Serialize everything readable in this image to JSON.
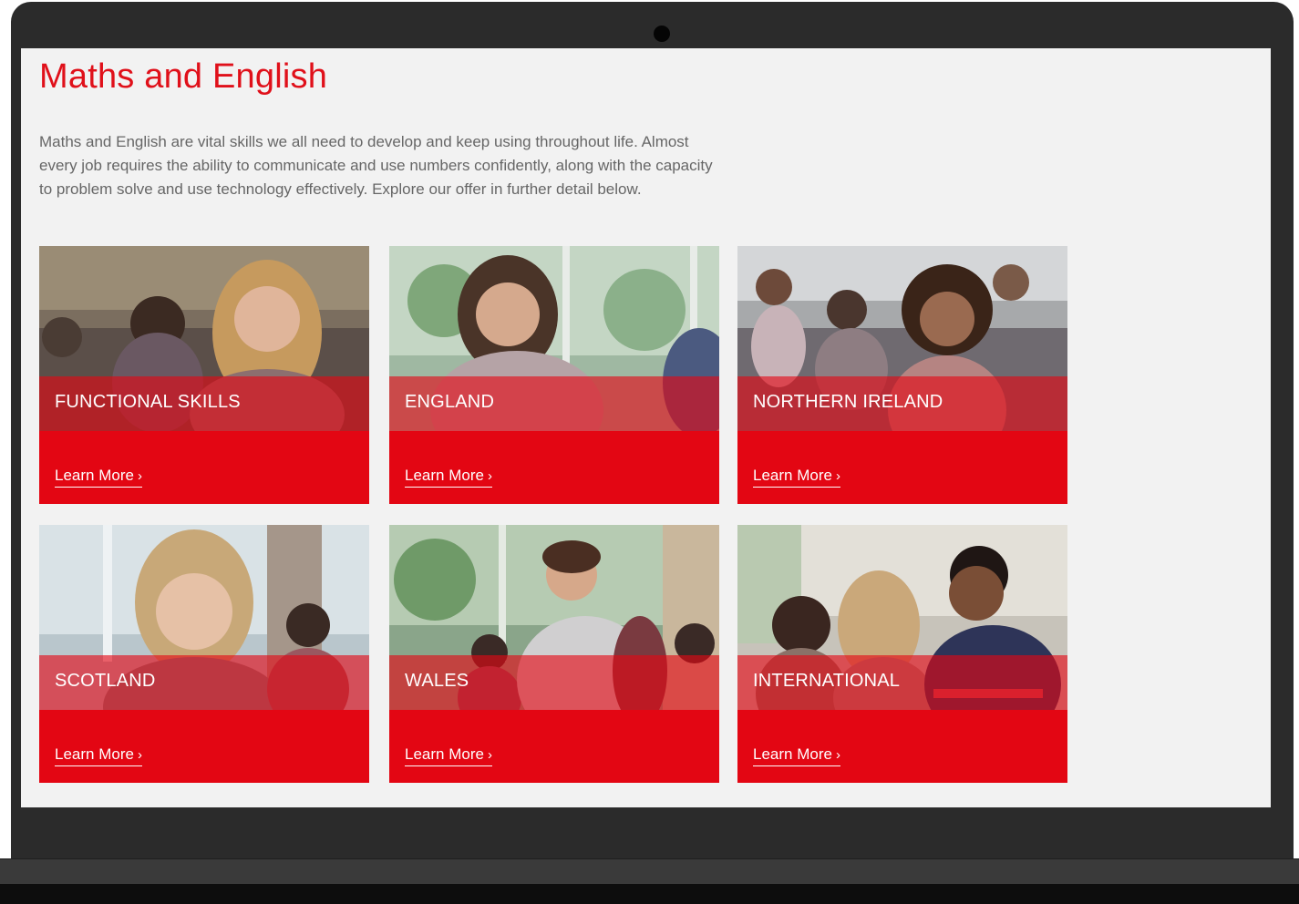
{
  "page": {
    "title": "Maths and English",
    "intro": "Maths and English are vital skills we all need to develop and keep using throughout life. Almost every job requires the ability to communicate and use numbers confidently, along with the capacity to problem solve and use technology effectively. Explore our offer in further detail below."
  },
  "cards": [
    {
      "title": "FUNCTIONAL SKILLS",
      "link": "Learn More",
      "chevron": "›"
    },
    {
      "title": "ENGLAND",
      "link": "Learn More",
      "chevron": "›"
    },
    {
      "title": "NORTHERN IRELAND",
      "link": "Learn More",
      "chevron": "›"
    },
    {
      "title": "SCOTLAND",
      "link": "Learn More",
      "chevron": "›"
    },
    {
      "title": "WALES",
      "link": "Learn More",
      "chevron": "›"
    },
    {
      "title": "INTERNATIONAL",
      "link": "Learn More",
      "chevron": "›"
    }
  ],
  "colors": {
    "accent": "#e30613",
    "heading": "#e0101a",
    "body_text": "#666666",
    "screen_bg": "#f2f2f2",
    "bezel": "#2b2b2b"
  },
  "icons": {
    "chevron": "chevron-right-icon",
    "camera": "webcam-icon"
  }
}
